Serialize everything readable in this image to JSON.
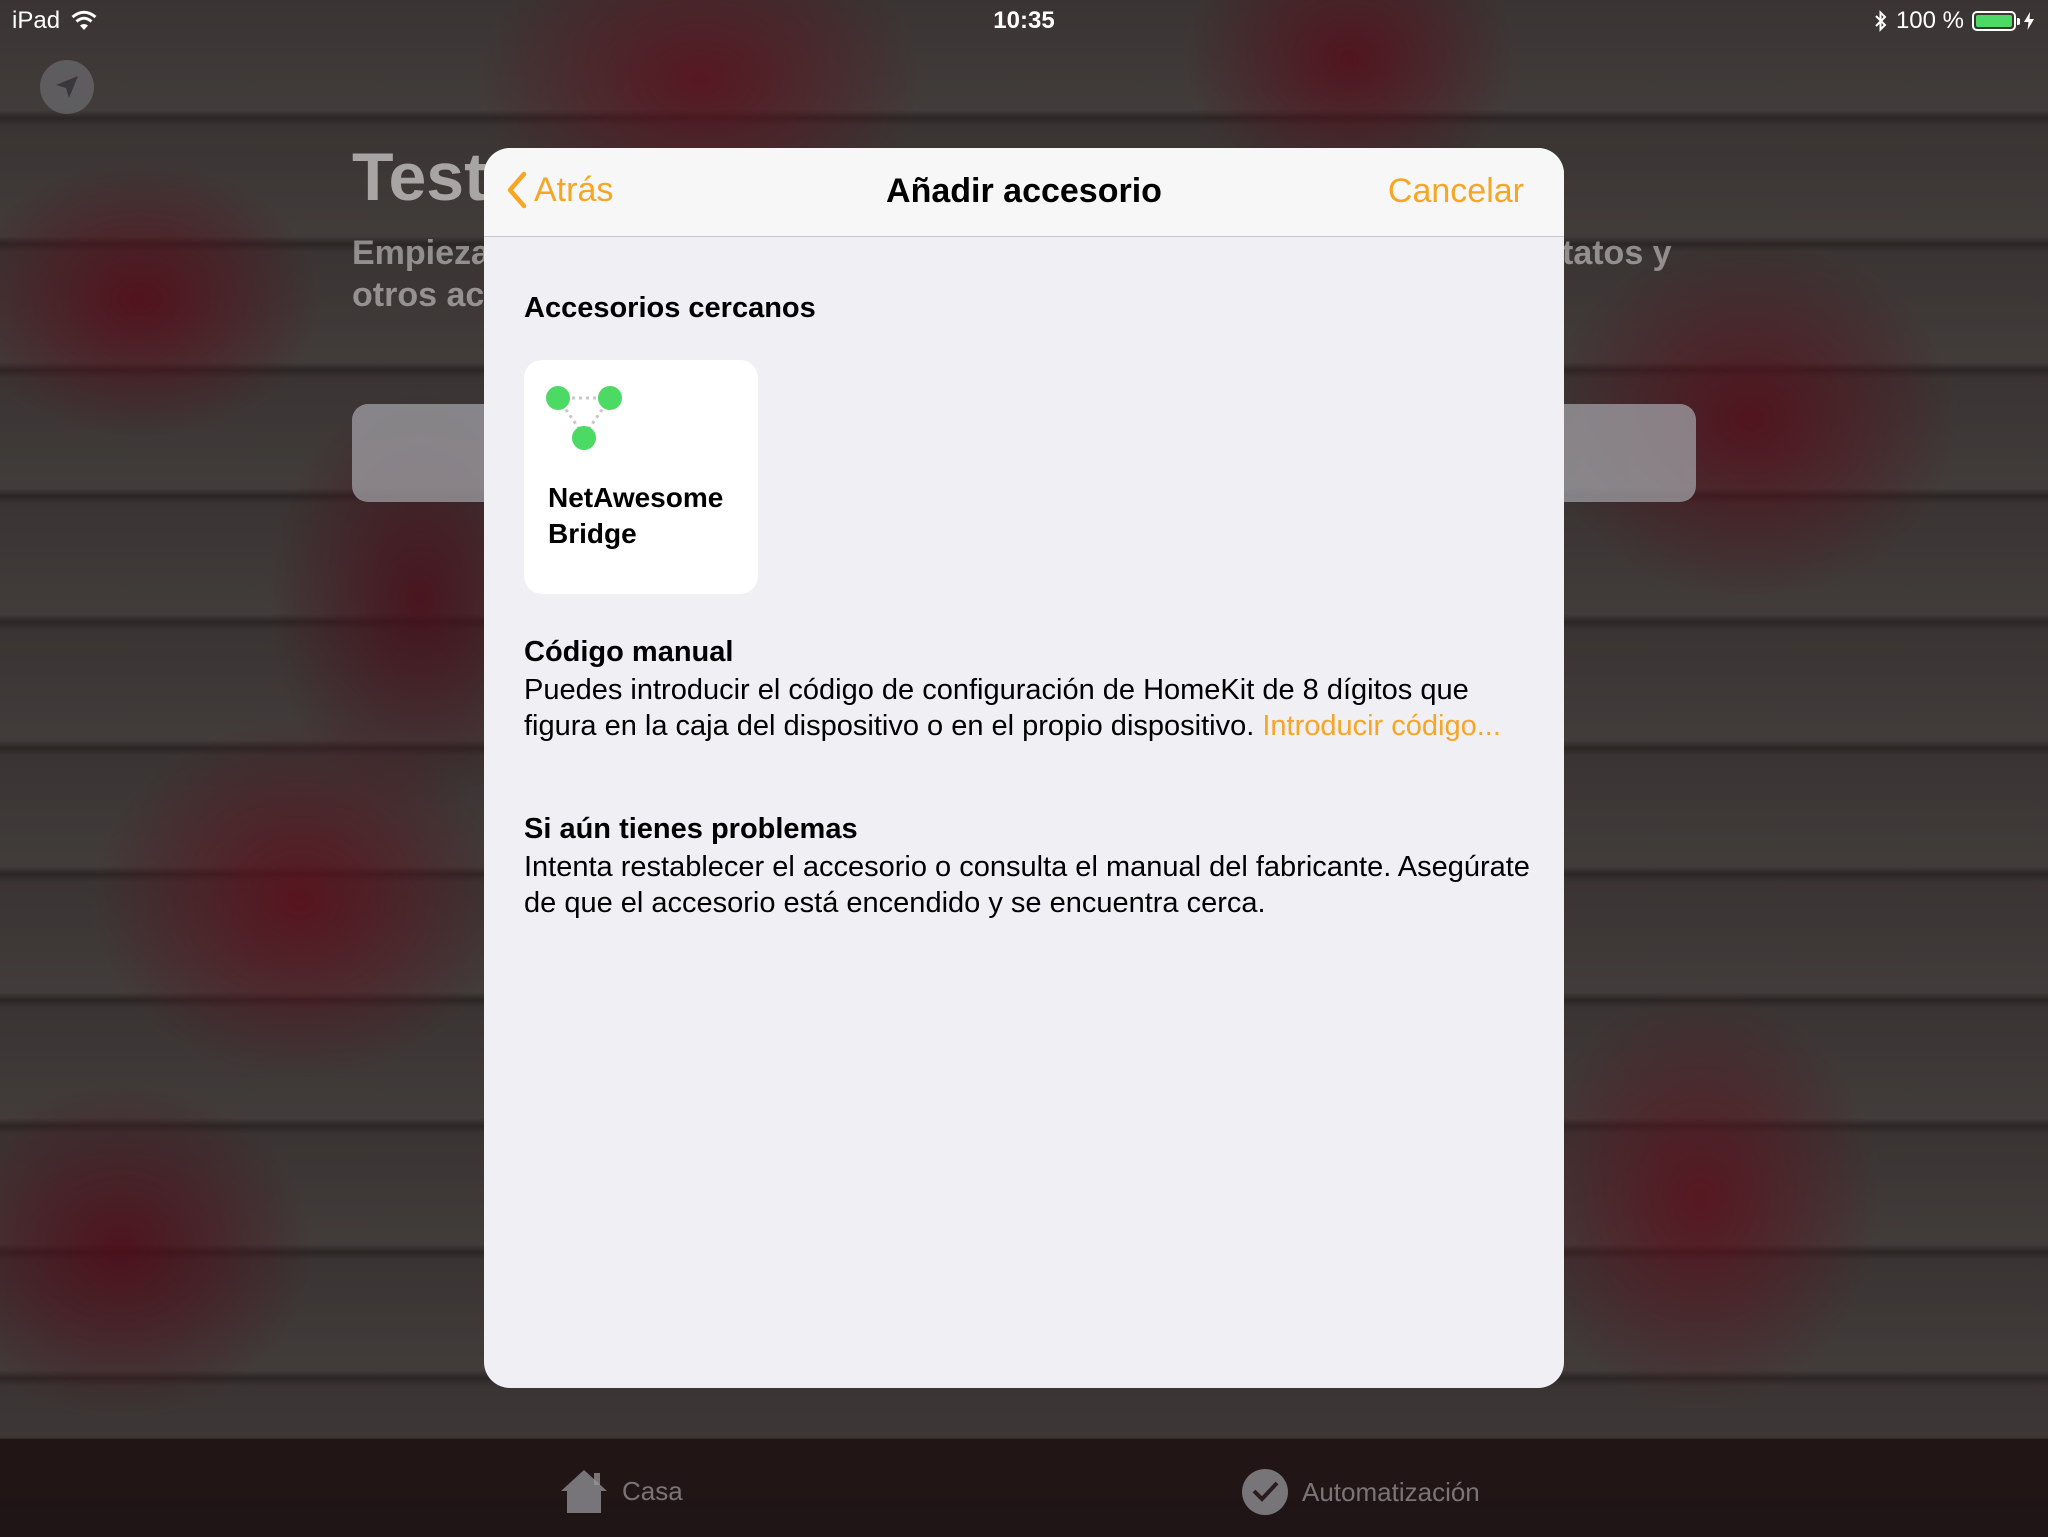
{
  "status_bar": {
    "device": "iPad",
    "time": "10:35",
    "battery": "100 %",
    "battery_level": 1.0
  },
  "background": {
    "title": "Test",
    "subtitle_line1_left": "Empieza",
    "subtitle_line1_right": "tatos y",
    "subtitle_line2_left": "otros ac"
  },
  "modal": {
    "nav": {
      "back_label": "Atrás",
      "title": "Añadir accesorio",
      "cancel_label": "Cancelar"
    },
    "nearby": {
      "heading": "Accesorios cercanos",
      "accessories": [
        {
          "name": "NetAwesome Bridge",
          "icon": "bridge-icon"
        }
      ]
    },
    "manual": {
      "heading": "Código manual",
      "body": "Puedes introducir el código de configuración de HomeKit de 8 dígitos que figura en la caja del dispositivo o en el propio dispositivo. ",
      "link": "Introducir código..."
    },
    "help": {
      "heading": "Si aún tienes problemas",
      "body": "Intenta restablecer el accesorio o consulta el manual del fabricante. Asegúrate de que el accesorio está encendido y se encuentra cerca."
    }
  },
  "tab_bar": {
    "tabs": [
      {
        "label": "Casa",
        "icon": "house-icon"
      },
      {
        "label": "Automatización",
        "icon": "automation-icon"
      }
    ]
  },
  "colors": {
    "accent": "#f5a623",
    "modal_bg": "#efeff4",
    "tile_bg": "#ffffff",
    "icon_green": "#4cd964"
  }
}
